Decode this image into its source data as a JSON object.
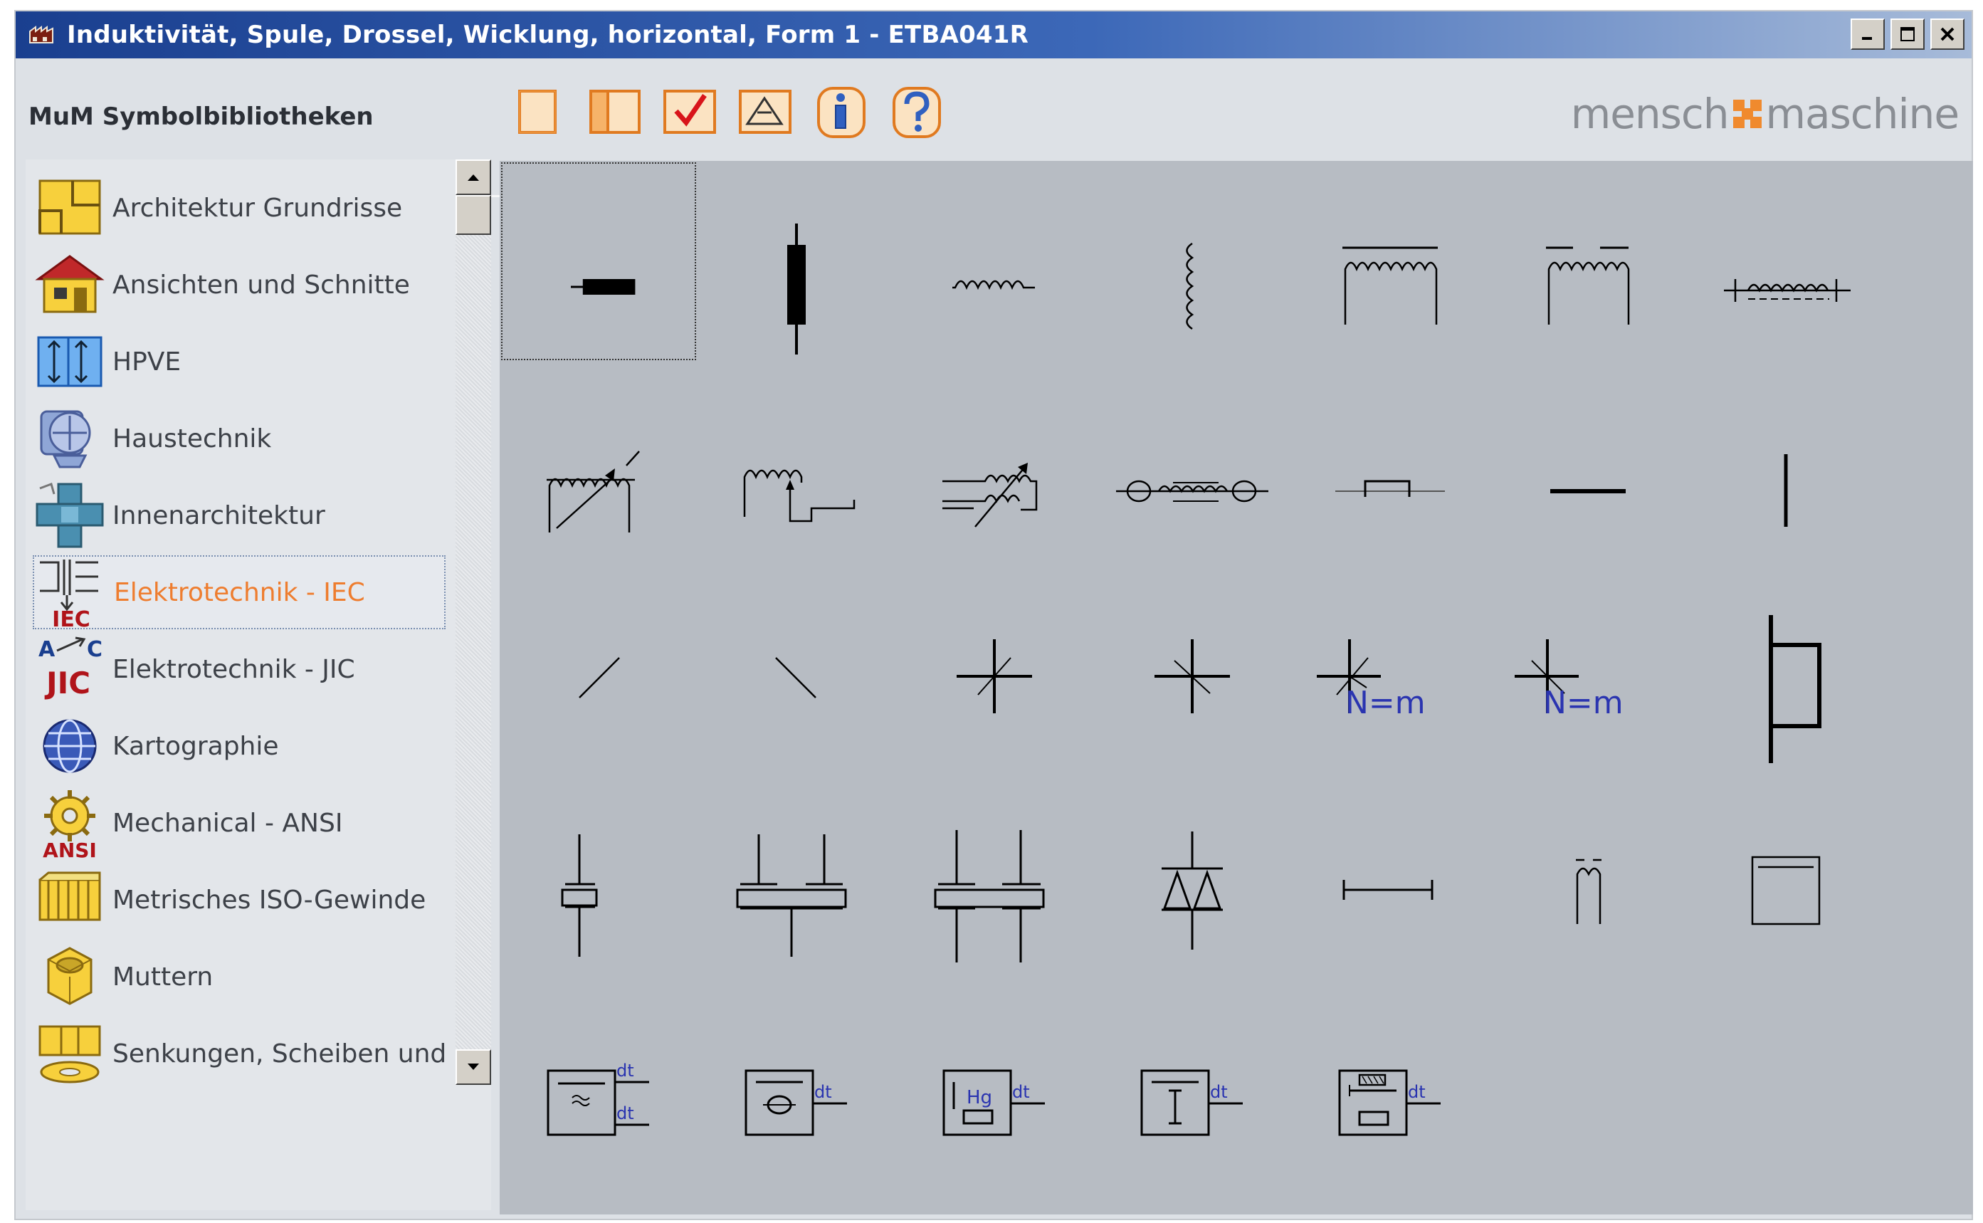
{
  "window": {
    "title": "Induktivität, Spule, Drossel, Wicklung, horizontal, Form 1  -  ETBA041R",
    "controls": [
      "minimize-icon",
      "maximize-icon",
      "close-icon"
    ]
  },
  "toolbar": {
    "library_label": "MuM Symbolbibliotheken",
    "buttons": [
      {
        "icon": "new-page-icon"
      },
      {
        "icon": "open-book-icon"
      },
      {
        "icon": "checkmark-icon"
      },
      {
        "icon": "insert-symbol-icon"
      },
      {
        "icon": "info-icon"
      },
      {
        "icon": "help-icon"
      }
    ],
    "brand": {
      "left": "mensch",
      "right": "maschine",
      "accent": "#f08a2e"
    }
  },
  "sidebar": {
    "selected_index": 5,
    "items": [
      {
        "label": "Architektur Grundrisse",
        "icon": "floorplan-icon"
      },
      {
        "label": "Ansichten und Schnitte",
        "icon": "house-icon"
      },
      {
        "label": "HPVE",
        "icon": "hpve-icon"
      },
      {
        "label": "Haustechnik",
        "icon": "fan-icon"
      },
      {
        "label": "Innenarchitektur",
        "icon": "furniture-icon"
      },
      {
        "label": "Elektrotechnik - IEC",
        "icon": "iec-icon",
        "badge": "IEC"
      },
      {
        "label": "Elektrotechnik - JIC",
        "icon": "jic-icon",
        "badge": "JIC"
      },
      {
        "label": "Kartographie",
        "icon": "globe-icon"
      },
      {
        "label": "Mechanical - ANSI",
        "icon": "gear-icon",
        "badge": "ANSI"
      },
      {
        "label": "Metrisches ISO-Gewinde",
        "icon": "thread-icon"
      },
      {
        "label": "Muttern",
        "icon": "nut-icon"
      },
      {
        "label": "Senkungen, Scheiben und Du",
        "icon": "washer-icon"
      }
    ]
  },
  "symbols": {
    "selected_index": 0,
    "items": [
      {
        "icon": "inductor-block-horizontal-icon"
      },
      {
        "icon": "inductor-block-vertical-icon"
      },
      {
        "icon": "inductor-coil-horizontal-icon"
      },
      {
        "icon": "inductor-coil-vertical-icon"
      },
      {
        "icon": "inductor-with-core-icon"
      },
      {
        "icon": "inductor-split-core-icon"
      },
      {
        "icon": "inductor-tapped-icon"
      },
      {
        "icon": "variable-inductor-icon"
      },
      {
        "icon": "inductor-with-tap-icon"
      },
      {
        "icon": "adjustable-inductor-icon"
      },
      {
        "icon": "ferrite-bead-icon"
      },
      {
        "icon": "small-rectangle-on-line-icon"
      },
      {
        "icon": "horizontal-bar-icon"
      },
      {
        "icon": "vertical-bar-icon"
      },
      {
        "icon": "diagonal-forward-icon"
      },
      {
        "icon": "diagonal-backward-icon"
      },
      {
        "icon": "crossing-icon"
      },
      {
        "icon": "crossing-alt-icon"
      },
      {
        "icon": "crossing-with-ratio-icon",
        "text": "N=m"
      },
      {
        "icon": "crossing-with-ratio-alt-icon",
        "text": "N=m"
      },
      {
        "icon": "bracket-vertical-icon"
      },
      {
        "icon": "crystal-icon"
      },
      {
        "icon": "dual-crystal-icon"
      },
      {
        "icon": "crystal-four-terminal-icon"
      },
      {
        "icon": "diode-bridge-icon"
      },
      {
        "icon": "terminated-line-icon"
      },
      {
        "icon": "small-coil-icon"
      },
      {
        "icon": "box-icon"
      },
      {
        "icon": "sensor-tilde-icon",
        "text": "dt"
      },
      {
        "icon": "sensor-circle-icon",
        "text": "dt"
      },
      {
        "icon": "sensor-hg-icon",
        "text": "dt",
        "inner": "Hg"
      },
      {
        "icon": "sensor-i-icon",
        "text": "dt"
      },
      {
        "icon": "sensor-heater-icon",
        "text": "dt"
      }
    ]
  }
}
